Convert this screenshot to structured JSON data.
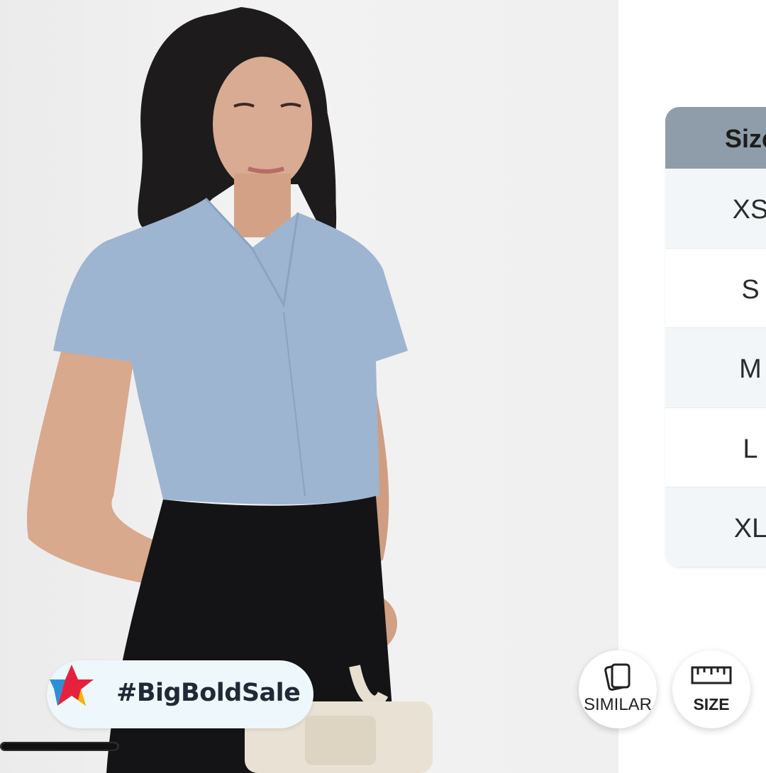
{
  "product_image": {
    "alt_icon": "model-photo"
  },
  "promo": {
    "hashtag": "#BigBoldSale",
    "star_colors": [
      "#e5223e",
      "#2d8fd6",
      "#f5b400"
    ]
  },
  "image_carousel": {
    "progress_fraction": 1.0
  },
  "size_chart": {
    "header": "Size",
    "sizes": [
      "XS",
      "S",
      "M",
      "L",
      "XL"
    ],
    "header_color": "#8e9da9"
  },
  "actions": {
    "similar_label": "SIMILAR",
    "size_label": "SIZE"
  }
}
